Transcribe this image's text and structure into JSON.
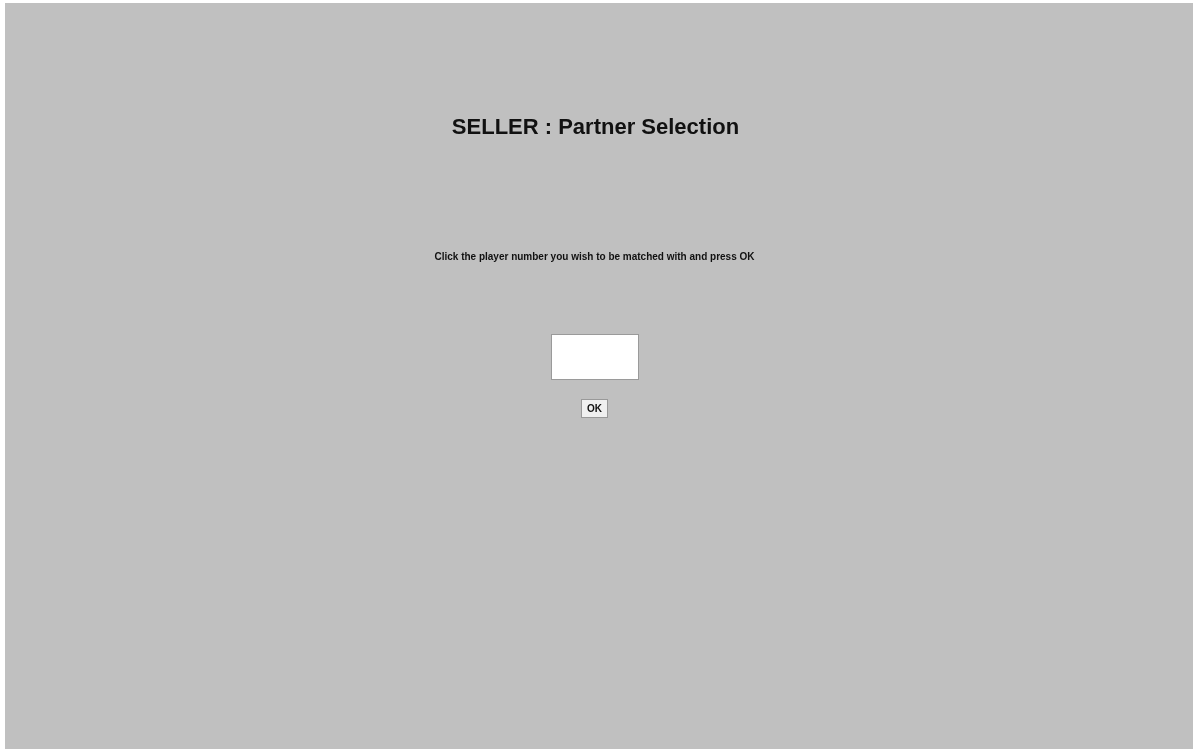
{
  "title": "SELLER : Partner Selection",
  "instruction": "Click the player number you wish to be matched with and press OK",
  "ok_button": {
    "label": "OK"
  }
}
